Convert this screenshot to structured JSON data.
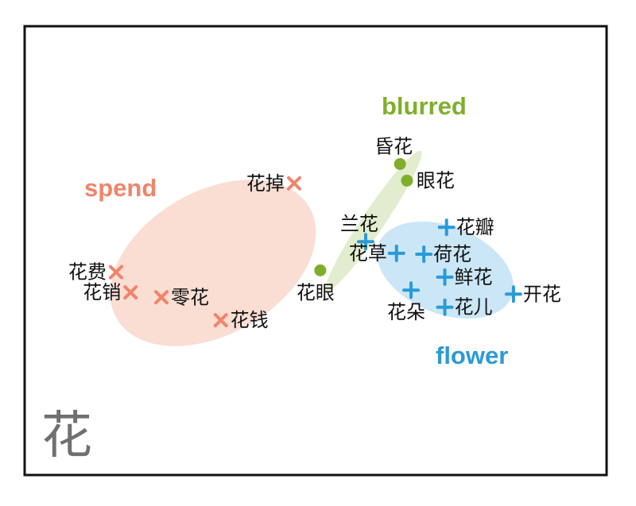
{
  "chart_data": {
    "type": "scatter",
    "title": "",
    "xlabel": "",
    "ylabel": "",
    "xlim": [
      0,
      100
    ],
    "ylim": [
      0,
      100
    ],
    "grid": false,
    "legend": "none",
    "corner_character": "花",
    "series": [
      {
        "name": "spend",
        "marker": "x",
        "color": "#F0846A",
        "region_color": "#F8CFC0",
        "points": [
          {
            "label": "花掉",
            "x": 46.3,
            "y": 65.0,
            "label_side": "left"
          },
          {
            "label": "花费",
            "x": 15.7,
            "y": 45.2,
            "label_side": "left"
          },
          {
            "label": "花销",
            "x": 18.2,
            "y": 40.7,
            "label_side": "left"
          },
          {
            "label": "零花",
            "x": 23.5,
            "y": 39.6,
            "label_side": "right"
          },
          {
            "label": "花钱",
            "x": 33.7,
            "y": 34.5,
            "label_side": "right"
          }
        ]
      },
      {
        "name": "blurred",
        "marker": "dot",
        "color": "#7FAF2A",
        "region_color": "#D9E8C2",
        "points": [
          {
            "label": "昏花",
            "x": 64.5,
            "y": 69.3,
            "label_side": "top"
          },
          {
            "label": "眼花",
            "x": 65.7,
            "y": 65.6,
            "label_side": "right"
          },
          {
            "label": "花眼",
            "x": 50.8,
            "y": 45.6,
            "label_side": "below"
          }
        ]
      },
      {
        "name": "flower",
        "marker": "plus",
        "color": "#2B9AD6",
        "region_color": "#BEE0F4",
        "points": [
          {
            "label": "兰花",
            "x": 58.6,
            "y": 52.0,
            "label_side": "top"
          },
          {
            "label": "花草",
            "x": 63.9,
            "y": 49.4,
            "label_side": "left"
          },
          {
            "label": "荷花",
            "x": 68.6,
            "y": 49.2,
            "label_side": "right"
          },
          {
            "label": "花瓣",
            "x": 72.5,
            "y": 55.2,
            "label_side": "right"
          },
          {
            "label": "鲜花",
            "x": 72.2,
            "y": 44.1,
            "label_side": "right"
          },
          {
            "label": "开花",
            "x": 84.0,
            "y": 40.3,
            "label_side": "right"
          },
          {
            "label": "花朵",
            "x": 66.4,
            "y": 41.2,
            "label_side": "below"
          },
          {
            "label": "花儿",
            "x": 72.2,
            "y": 37.4,
            "label_side": "right"
          }
        ]
      }
    ]
  }
}
